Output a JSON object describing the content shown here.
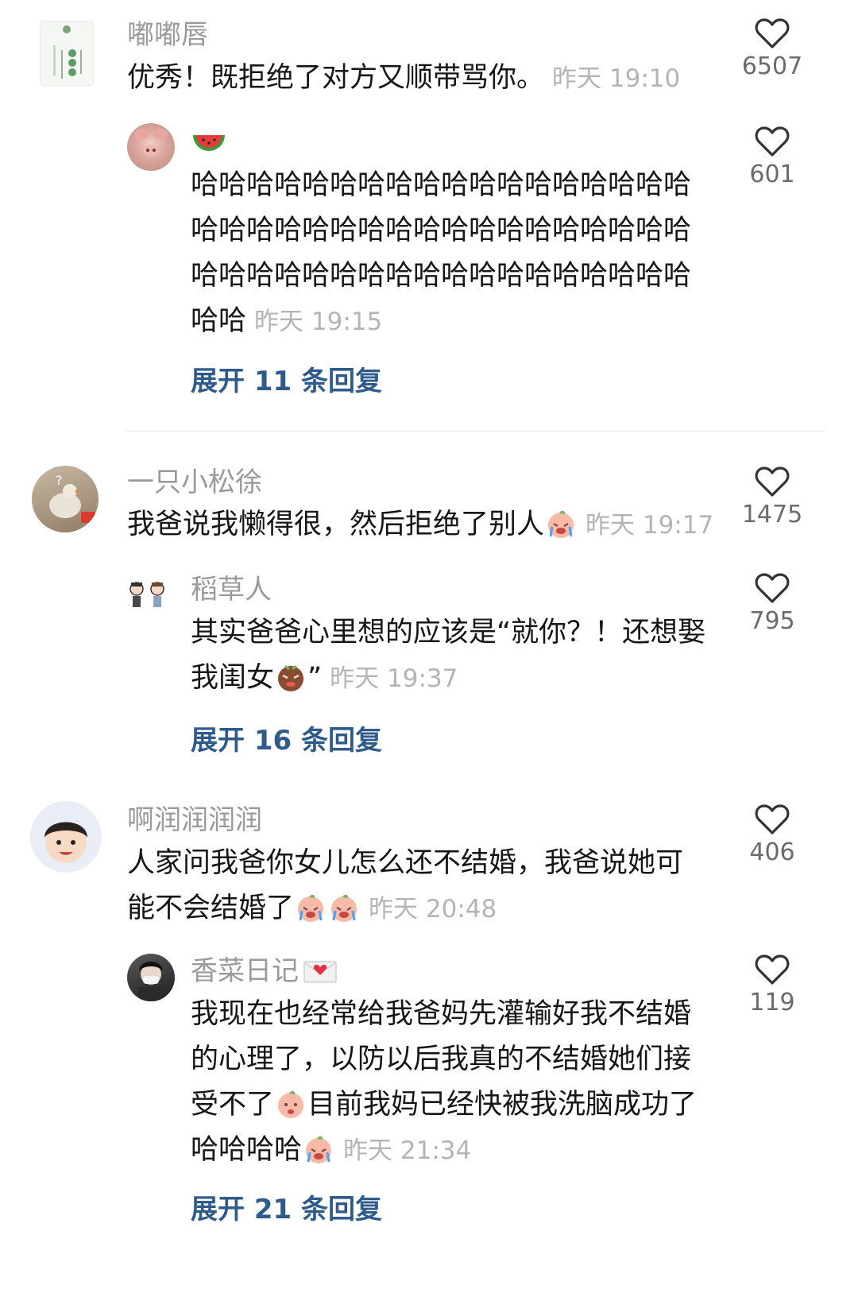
{
  "comments": [
    {
      "name": "嘟嘟唇",
      "text": "优秀！既拒绝了对方又顺带骂你。",
      "time": "昨天 19:10",
      "likes": "6507",
      "avatar": "poster-avatar",
      "reply": {
        "name": "🍉",
        "text": "哈哈哈哈哈哈哈哈哈哈哈哈哈哈哈哈哈哈哈哈哈哈哈哈哈哈哈哈哈哈哈哈哈哈哈哈哈哈哈哈哈哈哈哈哈哈哈哈哈哈哈哈哈哈哈哈",
        "time": "昨天 19:15",
        "likes": "601",
        "expand": "展开 11 条回复"
      }
    },
    {
      "name": "一只小松徐",
      "text": "我爸说我懒得很，然后拒绝了别人",
      "time": "昨天 19:17",
      "likes": "1475",
      "reply": {
        "name": "稻草人",
        "text_line1": "其实爸爸心里想的应该是“就你？！还想娶",
        "text_line2_pre": "我闺女",
        "text_line2_post": "”",
        "time": "昨天 19:37",
        "likes": "795",
        "expand": "展开 16 条回复"
      }
    },
    {
      "name": "啊润润润润",
      "text_line1": "人家问我爸你女儿怎么还不结婚，我爸说她可",
      "text_line2": "能不会结婚了",
      "time": "昨天 20:48",
      "likes": "406",
      "reply": {
        "name": "香菜日记",
        "line1": "我现在也经常给我爸妈先灌输好我不结婚",
        "line2": "的心理了，以防以后我真的不结婚她们接",
        "line3_pre": "受不了",
        "line3_post": "目前我妈已经快被我洗脑成功了",
        "line4": "哈哈哈哈",
        "time": "昨天 21:34",
        "likes": "119",
        "expand": "展开 21 条回复"
      }
    }
  ],
  "colors": {
    "link": "#2f5b8c",
    "time": "#b4b4b4",
    "name": "#9a9a9a"
  },
  "icons": [
    "heart-outline-icon",
    "crying-emoji",
    "angry-emoji",
    "sad-emoji",
    "heart-mail-icon"
  ]
}
